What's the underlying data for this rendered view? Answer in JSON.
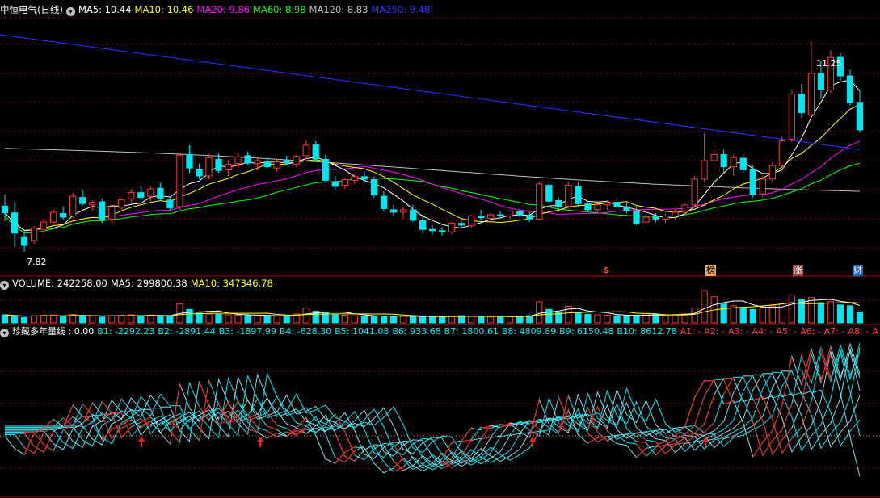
{
  "header": {
    "stock": "中恒电气(日线)",
    "ma5": "MA5: 10.44",
    "ma10": "MA10: 10.46",
    "ma20": "MA20: 9.86",
    "ma60": "MA60: 8.98",
    "ma120": "MA120: 8.83",
    "ma250": "MA250: 9.48"
  },
  "volume_legend": {
    "title": "VOLUME: 242258.00",
    "ma5": "MA5: 299800.38",
    "ma10": "MA10: 347346.78"
  },
  "indicator_legend": {
    "title": "珍藏多年量线 : 0.00",
    "b1": "B1: -2292.23",
    "b2": "B2: -2891.44",
    "b3": "B3: -1897.99",
    "b4": "B4: -628.30",
    "b5": "B5: 1041.08",
    "b6": "B6: 933.68",
    "b7": "B7: 1800.61",
    "b8": "B8: 4809.89",
    "b9": "B9: 6150.48",
    "b10": "B10: 8612.78",
    "a1": "A1: -",
    "a2": "A2: -",
    "a3": "A3: -",
    "a4": "A4: -",
    "a5": "A5: -",
    "a6": "A6: -",
    "a7": "A7: -",
    "a8": "A8: -",
    "a9": "A"
  },
  "markers": {
    "s": "$",
    "bang": "榜",
    "zhang": "涨",
    "cai": "财"
  },
  "colors": {
    "up": "#ff3b3b",
    "down": "#00e5ee",
    "ma5": "#ffffff",
    "ma10": "#ffff00",
    "ma20": "#ff00ff",
    "ma60": "#00ff00",
    "ma120": "#c0c0c0",
    "ma250": "#3333ff",
    "grid": "#8b0000"
  },
  "chart_data": [
    {
      "type": "candlestick",
      "pane": "price",
      "high_label": "11.25",
      "low_label": "7.82",
      "ylim": [
        7.5,
        11.6
      ],
      "ohlc": [
        [
          8.56,
          8.75,
          8.31,
          8.45
        ],
        [
          8.45,
          8.63,
          7.9,
          8.12
        ],
        [
          8.05,
          8.18,
          7.82,
          7.92
        ],
        [
          8.0,
          8.24,
          7.95,
          8.2
        ],
        [
          8.18,
          8.35,
          8.12,
          8.3
        ],
        [
          8.3,
          8.51,
          8.26,
          8.46
        ],
        [
          8.44,
          8.56,
          8.33,
          8.38
        ],
        [
          8.4,
          8.78,
          8.36,
          8.72
        ],
        [
          8.7,
          8.82,
          8.57,
          8.6
        ],
        [
          8.58,
          8.66,
          8.48,
          8.62
        ],
        [
          8.63,
          8.68,
          8.28,
          8.34
        ],
        [
          8.35,
          8.58,
          8.28,
          8.55
        ],
        [
          8.54,
          8.69,
          8.5,
          8.66
        ],
        [
          8.68,
          8.83,
          8.62,
          8.78
        ],
        [
          8.78,
          8.88,
          8.66,
          8.7
        ],
        [
          8.72,
          8.88,
          8.64,
          8.84
        ],
        [
          8.85,
          8.94,
          8.65,
          8.68
        ],
        [
          8.66,
          8.71,
          8.49,
          8.53
        ],
        [
          8.55,
          9.42,
          8.5,
          9.39
        ],
        [
          9.4,
          9.55,
          9.1,
          9.18
        ],
        [
          9.16,
          9.25,
          9.0,
          9.05
        ],
        [
          9.05,
          9.4,
          9.0,
          9.35
        ],
        [
          9.32,
          9.41,
          9.1,
          9.14
        ],
        [
          9.15,
          9.3,
          9.05,
          9.24
        ],
        [
          9.25,
          9.42,
          9.18,
          9.36
        ],
        [
          9.38,
          9.45,
          9.23,
          9.26
        ],
        [
          9.25,
          9.34,
          9.14,
          9.3
        ],
        [
          9.28,
          9.36,
          9.18,
          9.2
        ],
        [
          9.18,
          9.32,
          9.12,
          9.28
        ],
        [
          9.3,
          9.38,
          9.22,
          9.26
        ],
        [
          9.24,
          9.4,
          9.2,
          9.37
        ],
        [
          9.38,
          9.63,
          9.32,
          9.55
        ],
        [
          9.56,
          9.62,
          9.28,
          9.33
        ],
        [
          9.32,
          9.4,
          8.95,
          8.98
        ],
        [
          8.96,
          9.05,
          8.82,
          8.88
        ],
        [
          8.9,
          9.02,
          8.84,
          8.99
        ],
        [
          8.98,
          9.08,
          8.92,
          9.04
        ],
        [
          9.04,
          9.12,
          8.96,
          9.0
        ],
        [
          8.99,
          9.04,
          8.7,
          8.74
        ],
        [
          8.72,
          8.8,
          8.48,
          8.52
        ],
        [
          8.5,
          8.58,
          8.4,
          8.46
        ],
        [
          8.46,
          8.55,
          8.36,
          8.5
        ],
        [
          8.5,
          8.58,
          8.3,
          8.33
        ],
        [
          8.33,
          8.42,
          8.12,
          8.18
        ],
        [
          8.18,
          8.25,
          8.1,
          8.16
        ],
        [
          8.16,
          8.22,
          8.08,
          8.15
        ],
        [
          8.14,
          8.3,
          8.1,
          8.28
        ],
        [
          8.28,
          8.35,
          8.2,
          8.25
        ],
        [
          8.24,
          8.42,
          8.2,
          8.4
        ],
        [
          8.4,
          8.5,
          8.33,
          8.37
        ],
        [
          8.36,
          8.45,
          8.28,
          8.42
        ],
        [
          8.42,
          8.48,
          8.36,
          8.4
        ],
        [
          8.4,
          8.5,
          8.35,
          8.48
        ],
        [
          8.47,
          8.52,
          8.38,
          8.41
        ],
        [
          8.41,
          8.46,
          8.3,
          8.35
        ],
        [
          8.35,
          8.96,
          8.33,
          8.92
        ],
        [
          8.9,
          8.95,
          8.6,
          8.64
        ],
        [
          8.65,
          8.7,
          8.5,
          8.55
        ],
        [
          8.56,
          8.95,
          8.52,
          8.9
        ],
        [
          8.88,
          8.95,
          8.55,
          8.6
        ],
        [
          8.6,
          8.65,
          8.46,
          8.5
        ],
        [
          8.5,
          8.62,
          8.46,
          8.58
        ],
        [
          8.58,
          8.66,
          8.5,
          8.62
        ],
        [
          8.62,
          8.7,
          8.52,
          8.55
        ],
        [
          8.55,
          8.62,
          8.44,
          8.48
        ],
        [
          8.48,
          8.56,
          8.25,
          8.28
        ],
        [
          8.3,
          8.42,
          8.2,
          8.38
        ],
        [
          8.38,
          8.45,
          8.3,
          8.35
        ],
        [
          8.35,
          8.44,
          8.28,
          8.4
        ],
        [
          8.4,
          8.5,
          8.34,
          8.46
        ],
        [
          8.46,
          8.6,
          8.42,
          8.58
        ],
        [
          8.58,
          9.05,
          8.55,
          9.0
        ],
        [
          9.0,
          9.75,
          8.95,
          9.3
        ],
        [
          9.3,
          9.55,
          8.8,
          9.4
        ],
        [
          9.4,
          9.48,
          9.1,
          9.2
        ],
        [
          9.2,
          9.4,
          9.05,
          9.35
        ],
        [
          9.34,
          9.42,
          9.1,
          9.15
        ],
        [
          9.15,
          9.22,
          8.7,
          8.75
        ],
        [
          8.76,
          9.05,
          8.7,
          9.0
        ],
        [
          9.0,
          9.28,
          8.95,
          9.22
        ],
        [
          9.22,
          9.7,
          9.18,
          9.62
        ],
        [
          9.65,
          10.45,
          9.6,
          10.38
        ],
        [
          10.38,
          10.55,
          10.0,
          10.08
        ],
        [
          10.05,
          11.25,
          10.0,
          10.72
        ],
        [
          10.72,
          10.92,
          10.3,
          10.45
        ],
        [
          10.45,
          11.1,
          10.4,
          10.98
        ],
        [
          10.98,
          11.05,
          10.6,
          10.68
        ],
        [
          10.68,
          10.78,
          10.2,
          10.25
        ],
        [
          10.25,
          10.45,
          9.75,
          9.8
        ]
      ],
      "ma250_endpoints": [
        11.35,
        9.48
      ]
    },
    {
      "type": "bar",
      "pane": "volume",
      "values": [
        180,
        150,
        120,
        160,
        170,
        175,
        140,
        190,
        160,
        150,
        130,
        160,
        170,
        180,
        160,
        175,
        150,
        140,
        420,
        300,
        220,
        200,
        190,
        180,
        170,
        165,
        160,
        155,
        150,
        160,
        200,
        330,
        260,
        240,
        180,
        170,
        160,
        150,
        140,
        145,
        150,
        155,
        140,
        130,
        135,
        140,
        150,
        160,
        150,
        140,
        130,
        135,
        140,
        150,
        160,
        470,
        300,
        240,
        370,
        230,
        190,
        180,
        170,
        160,
        150,
        170,
        210,
        190,
        160,
        180,
        200,
        330,
        720,
        580,
        420,
        380,
        330,
        300,
        350,
        380,
        420,
        620,
        520,
        560,
        450,
        470,
        400,
        380,
        242
      ]
    },
    {
      "type": "line",
      "pane": "indicator",
      "series_names": [
        "B1",
        "B2",
        "B3",
        "B4",
        "B5",
        "B6",
        "B7",
        "B8",
        "B9",
        "B10"
      ],
      "values": [
        -2292.23,
        -2891.44,
        -1897.99,
        -628.3,
        1041.08,
        933.68,
        1800.61,
        4809.89,
        6150.48,
        8612.78
      ]
    }
  ]
}
